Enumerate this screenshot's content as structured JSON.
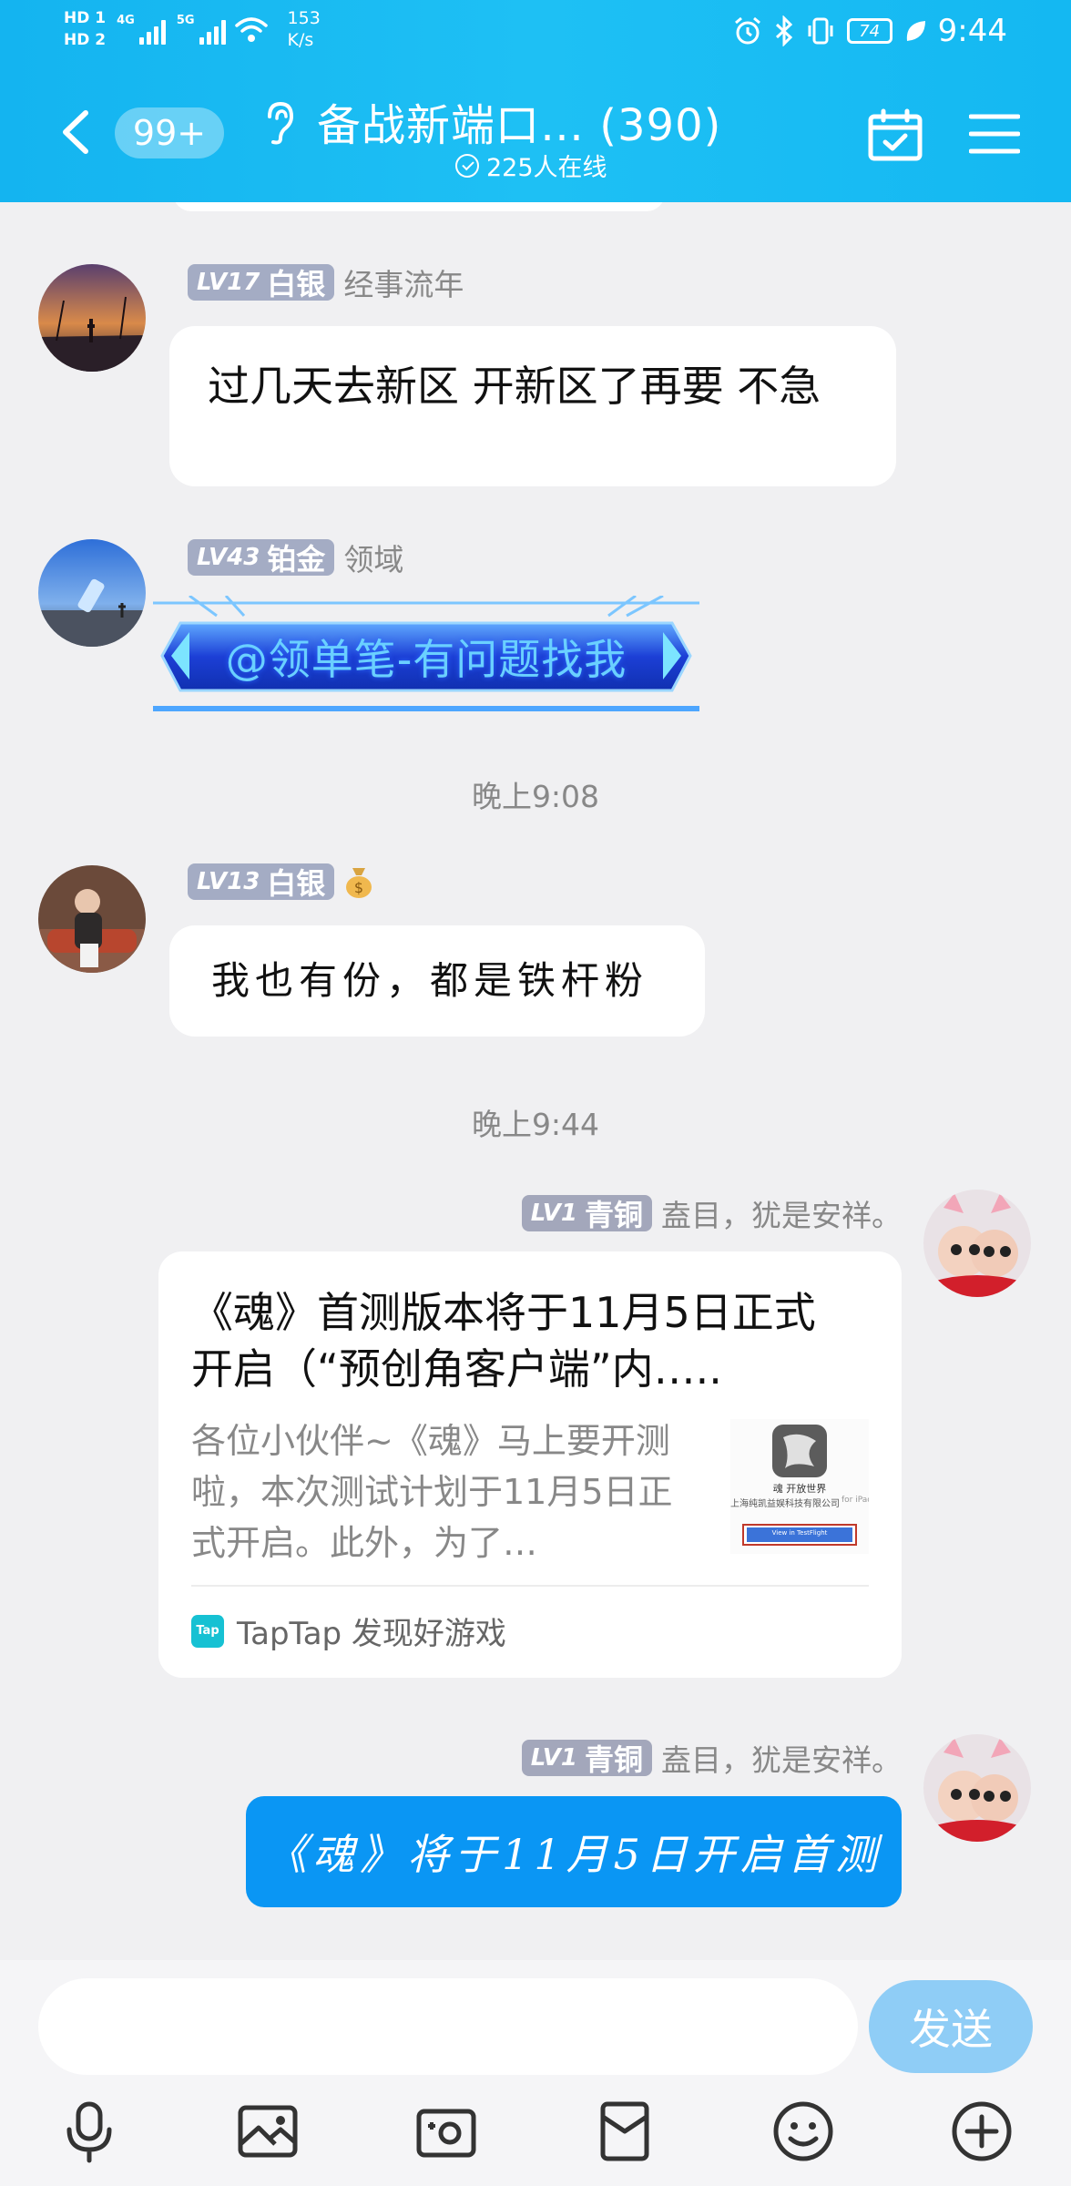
{
  "status_bar": {
    "hd1": "HD 1",
    "hd2": "HD 2",
    "net1": "4G",
    "net2": "5G",
    "speed_value": "153",
    "speed_unit": "K/s",
    "battery": "74",
    "time": "9:44"
  },
  "header": {
    "unread_badge": "99+",
    "title": "备战新端口…  (390)",
    "online": "225人在线"
  },
  "messages": [
    {
      "level": "LV17",
      "rank": "白银",
      "name": "经事流年",
      "text": "过几天去新区 开新区了再要 不急"
    },
    {
      "level": "LV43",
      "rank": "铂金",
      "name": "领域",
      "banner_text": "@领单笔-有问题找我"
    },
    {
      "level": "LV13",
      "rank": "白银",
      "name_icon": "money-bag-icon",
      "text": "我也有份，都是铁杆粉"
    },
    {
      "level": "LV1",
      "rank": "青铜",
      "name": "盍目，犹是安祥。",
      "card": {
        "title": "《魂》首测版本将于11月5日正式开启（“预创角客户端”内…..",
        "desc": "各位小伙伴~《魂》马上要开测啦，本次测试计划于11月5日正式开启。此外，为了…",
        "thumb_caption_1": "魂 开放世界",
        "thumb_caption_2": "上海纯凯益娱科技有限公司",
        "thumb_caption_3": "for iPad",
        "thumb_button": "View in TestFlight",
        "source_logo": "Tap",
        "source": "TapTap 发现好游戏"
      }
    },
    {
      "level": "LV1",
      "rank": "青铜",
      "name": "盍目，犹是安祥。",
      "text": "《魂》将于11月5日开启首测"
    }
  ],
  "time_separators": [
    "晚上9:08",
    "晚上9:44"
  ],
  "input": {
    "placeholder": "",
    "send_label": "发送"
  },
  "toolbar": [
    "microphone-icon",
    "image-icon",
    "camera-icon",
    "red-packet-icon",
    "emoji-icon",
    "plus-icon"
  ],
  "colors": {
    "header": "#14b4f0",
    "send_button": "#8fcdf6",
    "blue_bubble": "#0a96f4"
  }
}
